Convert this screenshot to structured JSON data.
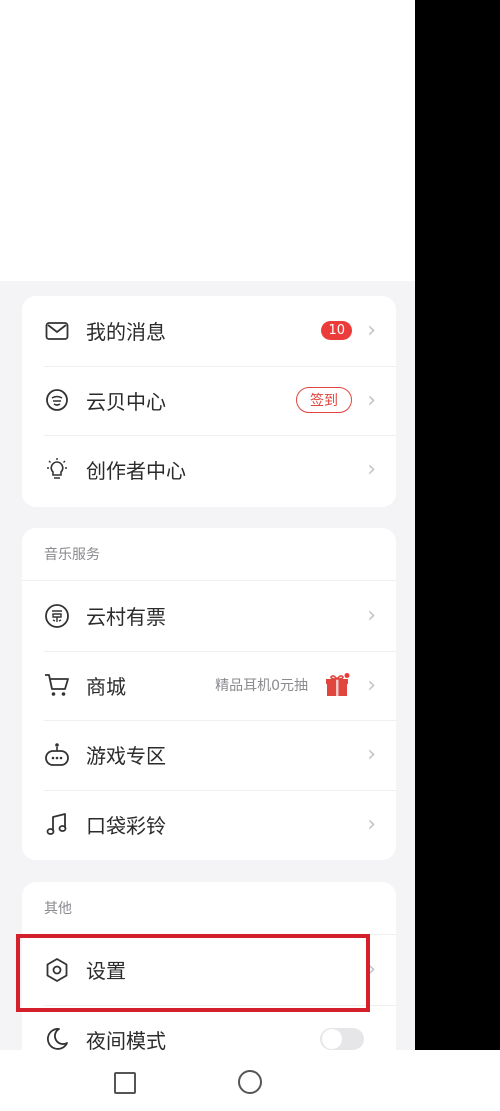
{
  "menu_top": {
    "messages": {
      "label": "我的消息",
      "count": "10"
    },
    "cloud_shells": {
      "label": "云贝中心",
      "checkin": "签到"
    },
    "creator": {
      "label": "创作者中心"
    }
  },
  "music_services": {
    "title": "音乐服务",
    "tickets": {
      "label": "云村有票"
    },
    "mall": {
      "label": "商城",
      "promo": "精品耳机0元抽"
    },
    "games": {
      "label": "游戏专区"
    },
    "ringtones": {
      "label": "口袋彩铃"
    }
  },
  "others": {
    "title": "其他",
    "settings": {
      "label": "设置"
    },
    "night_mode": {
      "label": "夜间模式",
      "enabled": false
    }
  },
  "icons": {
    "messages": "envelope-icon",
    "cloud_shells": "coin-icon",
    "creator": "lightbulb-icon",
    "tickets": "ticket-icon",
    "mall": "cart-icon",
    "games": "gamepad-icon",
    "ringtones": "music-note-icon",
    "settings": "hexagon-settings-icon",
    "night_mode": "moon-icon",
    "gift": "gift-icon"
  },
  "colors": {
    "accent": "#ec3b3b",
    "highlight": "#d4202a"
  }
}
